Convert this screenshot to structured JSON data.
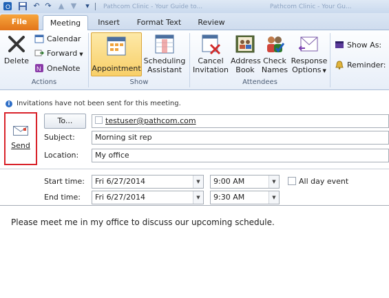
{
  "titlebar": {
    "doc_tabs": [
      "Pathcom Clinic - Your Guide to...",
      "Pathcom Clinic - Your Gu..."
    ]
  },
  "tabs": [
    {
      "label": "File"
    },
    {
      "label": "Meeting"
    },
    {
      "label": "Insert"
    },
    {
      "label": "Format Text"
    },
    {
      "label": "Review"
    }
  ],
  "ribbon": {
    "actions": {
      "delete": "Delete",
      "calendar": "Calendar",
      "forward": "Forward",
      "onenote": "OneNote",
      "group_label": "Actions"
    },
    "show": {
      "appointment": "Appointment",
      "scheduling_line1": "Scheduling",
      "scheduling_line2": "Assistant",
      "group_label": "Show"
    },
    "attendees": {
      "cancel_line1": "Cancel",
      "cancel_line2": "Invitation",
      "address_line1": "Address",
      "address_line2": "Book",
      "check_line1": "Check",
      "check_line2": "Names",
      "response_line1": "Response",
      "response_line2": "Options",
      "group_label": "Attendees"
    },
    "options": {
      "show_as": "Show As:",
      "reminder": "Reminder:"
    }
  },
  "infobar": {
    "text": "Invitations have not been sent for this meeting."
  },
  "form": {
    "send_label": "Send",
    "to_button": "To...",
    "to_value": "testuser@pathcom.com",
    "subject_label": "Subject:",
    "subject_value": "Morning sit rep",
    "location_label": "Location:",
    "location_value": "My office",
    "start_label": "Start time:",
    "start_date": "Fri 6/27/2014",
    "start_time": "9:00 AM",
    "end_label": "End time:",
    "end_date": "Fri 6/27/2014",
    "end_time": "9:30 AM",
    "all_day_label": "All day event",
    "all_day_checked": false
  },
  "body": {
    "text": "Please meet me in my office to discuss our upcoming schedule."
  },
  "colors": {
    "file_tab": "#e2751a",
    "highlight_box": "#d9222a",
    "appointment_active": "#fbd97c"
  }
}
